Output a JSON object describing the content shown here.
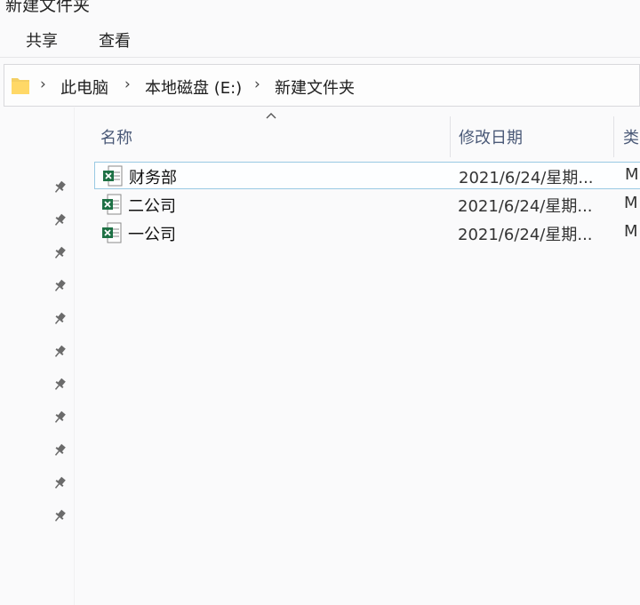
{
  "window": {
    "title": "新建文件夹"
  },
  "ribbon": {
    "tabs": [
      {
        "label": "共享"
      },
      {
        "label": "查看"
      }
    ]
  },
  "address": {
    "crumbs": [
      {
        "label": "此电脑"
      },
      {
        "label": "本地磁盘 (E:)"
      },
      {
        "label": "新建文件夹"
      }
    ],
    "separator": "›"
  },
  "nav": {
    "pins": 11,
    "pin_icon": "pin-icon"
  },
  "columns": [
    {
      "label": "名称"
    },
    {
      "label": "修改日期"
    },
    {
      "label": "类"
    }
  ],
  "files": [
    {
      "name": "财务部",
      "modified": "2021/6/24/星期...",
      "type": "M",
      "icon": "excel-file-icon",
      "selected": true
    },
    {
      "name": "二公司",
      "modified": "2021/6/24/星期...",
      "type": "M",
      "icon": "excel-file-icon",
      "selected": false
    },
    {
      "name": "一公司",
      "modified": "2021/6/24/星期...",
      "type": "M",
      "icon": "excel-file-icon",
      "selected": false
    }
  ],
  "colors": {
    "excel_green": "#1e7145",
    "selection_border": "#99c9e3",
    "folder_yellow": "#f4cf63",
    "header_text": "#4b5a78"
  }
}
